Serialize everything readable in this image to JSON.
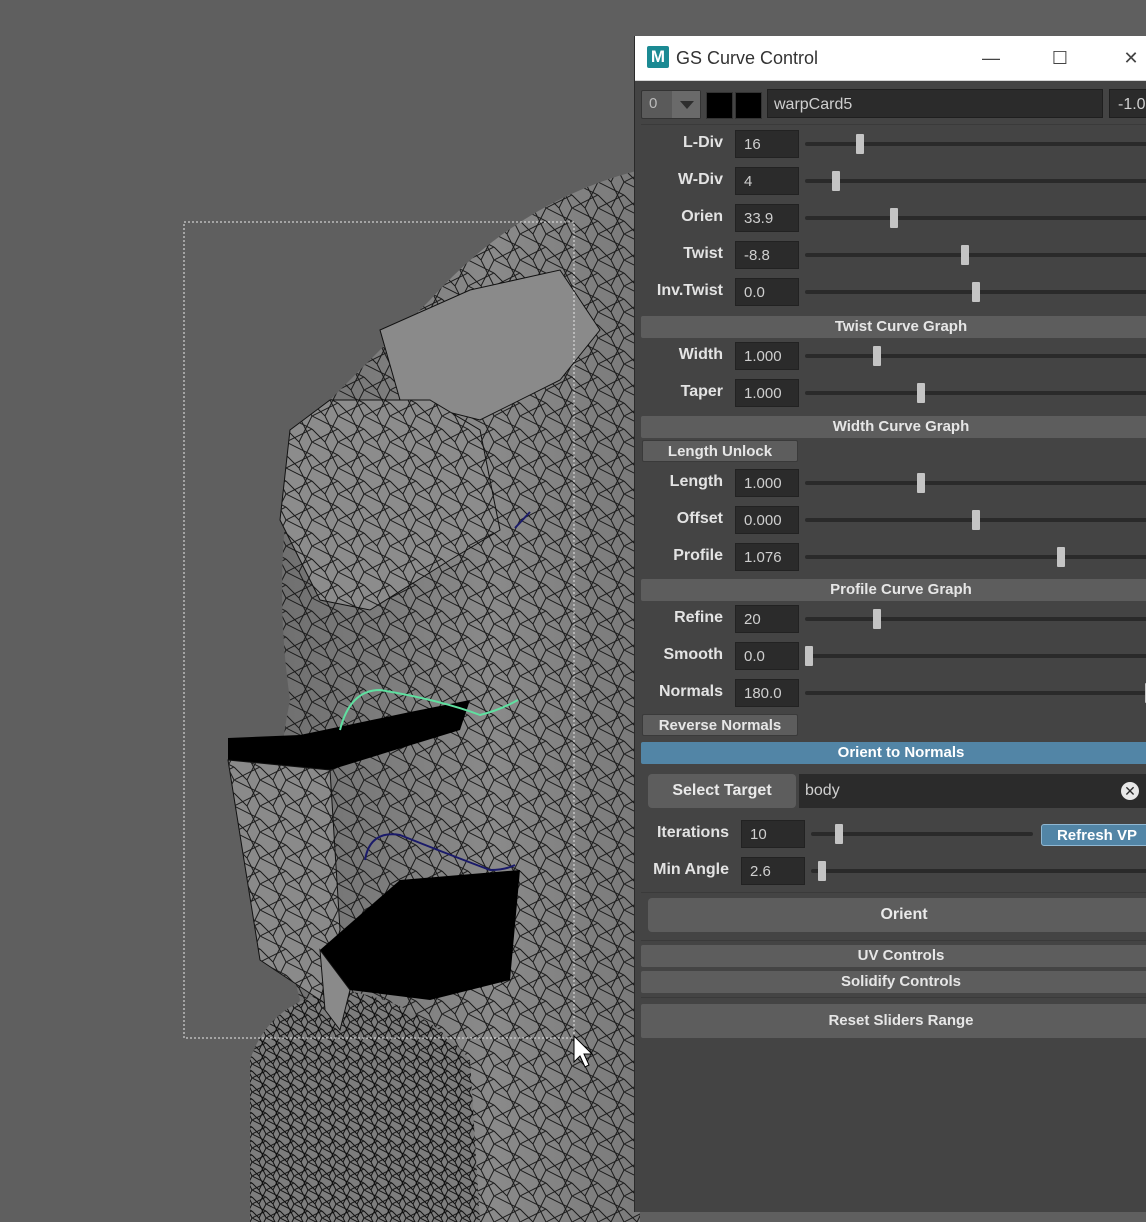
{
  "window": {
    "title": "GS Curve Control",
    "app_icon_letter": "M",
    "minimize_glyph": "—",
    "maximize_glyph": "☐",
    "close_glyph": "✕"
  },
  "header": {
    "layer_value": "0",
    "curve_name": "warpCard5",
    "extra_value": "-1.0"
  },
  "sliders_top": [
    {
      "label": "L-Div",
      "value": "16",
      "position": 0.15
    },
    {
      "label": "W-Div",
      "value": "4",
      "position": 0.08
    },
    {
      "label": "Orien",
      "value": "33.9",
      "position": 0.25
    },
    {
      "label": "Twist",
      "value": "-8.8",
      "position": 0.46
    },
    {
      "label": "Inv.Twist",
      "value": "0.0",
      "position": 0.49
    }
  ],
  "twist_graph_label": "Twist Curve Graph",
  "sliders_width": [
    {
      "label": "Width",
      "value": "1.000",
      "position": 0.2
    },
    {
      "label": "Taper",
      "value": "1.000",
      "position": 0.33
    }
  ],
  "width_graph_label": "Width Curve Graph",
  "length_unlock_label": "Length Unlock",
  "sliders_length": [
    {
      "label": "Length",
      "value": "1.000",
      "position": 0.33
    },
    {
      "label": "Offset",
      "value": "0.000",
      "position": 0.49
    },
    {
      "label": "Profile",
      "value": "1.076",
      "position": 0.74
    }
  ],
  "profile_graph_label": "Profile Curve Graph",
  "sliders_refine": [
    {
      "label": "Refine",
      "value": "20",
      "position": 0.2
    },
    {
      "label": "Smooth",
      "value": "0.0",
      "position": 0.0
    },
    {
      "label": "Normals",
      "value": "180.0",
      "position": 1.0
    }
  ],
  "reverse_normals_label": "Reverse Normals",
  "orient_section_label": "Orient to Normals",
  "select_target_label": "Select Target",
  "target_value": "body",
  "clear_glyph": "✕",
  "iterations": {
    "label": "Iterations",
    "value": "10",
    "position": 0.11
  },
  "refresh_vp_label": "Refresh VP",
  "min_angle": {
    "label": "Min Angle",
    "value": "2.6",
    "position": 0.02
  },
  "orient_button_label": "Orient",
  "uv_controls_label": "UV Controls",
  "solidify_controls_label": "Solidify Controls",
  "reset_sliders_label": "Reset Sliders Range",
  "colors": {
    "viewport_bg": "#5f5f5f",
    "panel_bg": "#444444",
    "accent_blue": "#5285a6",
    "curve_selected": "#5fe0a0",
    "curve_dark": "#1a1a6a"
  }
}
